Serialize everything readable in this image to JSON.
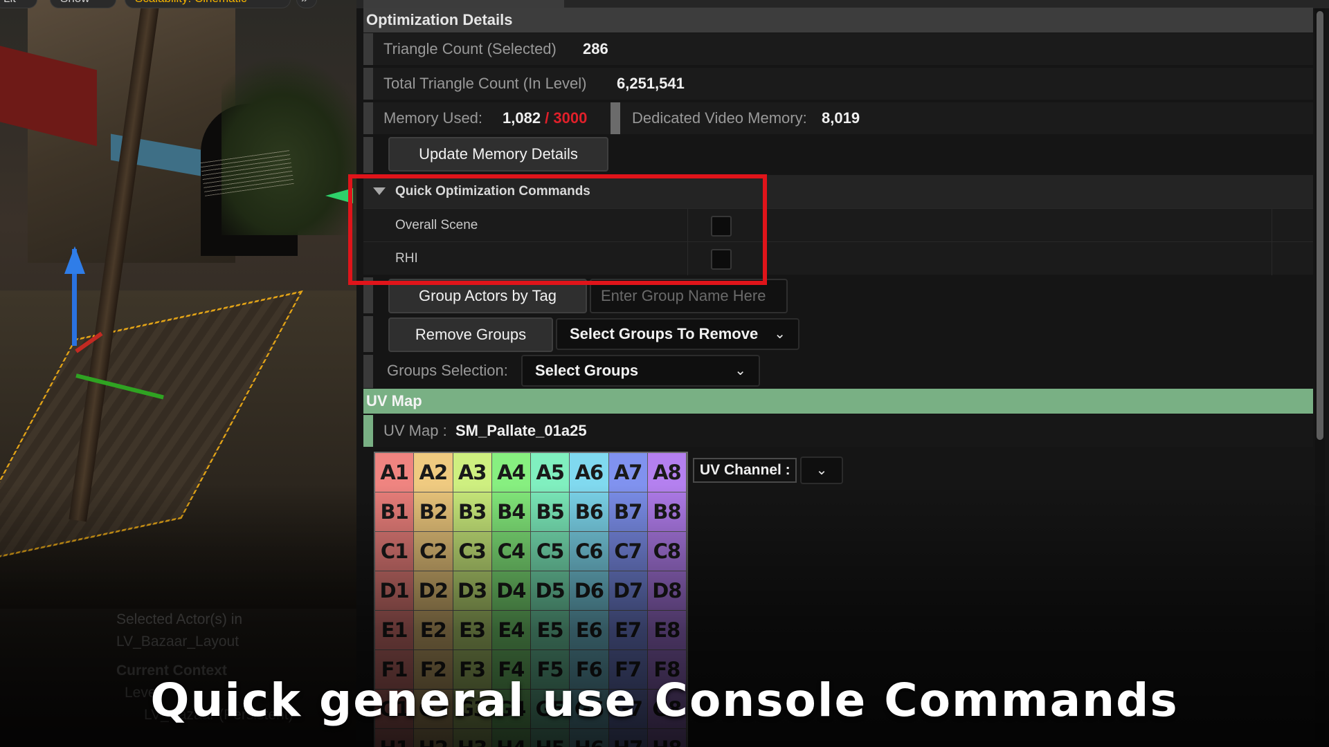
{
  "viewport": {
    "toolbar": [
      "Lit",
      "Show",
      "Scalability: Cinematic",
      "»"
    ],
    "info_lines": [
      "Selected Actor(s) in",
      "LV_Bazaar_Layout"
    ],
    "context_header": "Current Context",
    "level_label": "Level",
    "level_value": "LV_Bazaar (Persistent)"
  },
  "optimization": {
    "title": "Optimization Details",
    "triangle_selected_label": "Triangle Count (Selected)",
    "triangle_selected_value": "286",
    "triangle_total_label": "Total Triangle Count (In Level)",
    "triangle_total_value": "6,251,541",
    "memory_label": "Memory Used:",
    "memory_used": "1,082",
    "memory_sep": " / ",
    "memory_cap": "3000",
    "video_memory_label": "Dedicated Video Memory:",
    "video_memory_value": "8,019",
    "update_button": "Update Memory Details",
    "quick": {
      "title": "Quick Optimization Commands",
      "items": [
        {
          "label": "Overall Scene",
          "checked": false
        },
        {
          "label": "RHI",
          "checked": false
        }
      ]
    },
    "group_by_tag_button": "Group Actors by Tag",
    "group_name_placeholder": "Enter Group Name Here",
    "remove_groups_button": "Remove Groups",
    "remove_groups_combo": "Select Groups To Remove",
    "groups_selection_label": "Groups Selection:",
    "groups_selection_combo": "Select Groups"
  },
  "uv_map": {
    "title": "UV Map",
    "label": "UV Map :",
    "mesh_name": "SM_Pallate_01a25",
    "channel_label": "UV Channel :",
    "rows": [
      "A",
      "B",
      "C",
      "D",
      "E",
      "F",
      "G",
      "H"
    ],
    "columns": 8
  },
  "caption": "Quick general use Console Commands",
  "colors": {
    "accent_green": "#79b084",
    "highlight_red": "#e0141a",
    "memory_cap_red": "#e0202a"
  },
  "icons": {
    "expand": "triangle-down-icon",
    "combo": "chevron-down-icon"
  }
}
